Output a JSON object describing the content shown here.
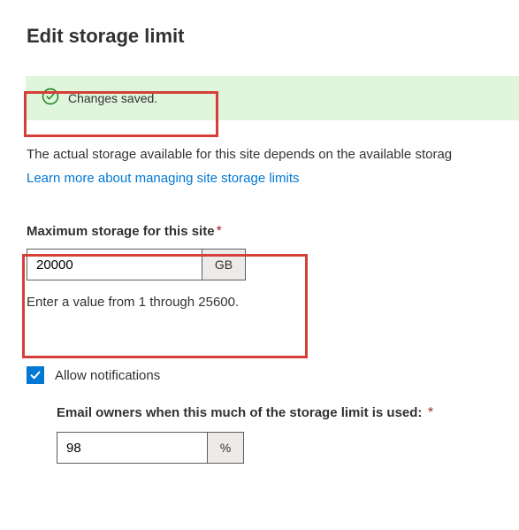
{
  "title": "Edit storage limit",
  "banner": {
    "text": "Changes saved."
  },
  "description": "The actual storage available for this site depends on the available storag",
  "link": "Learn more about managing site storage limits",
  "maxStorage": {
    "label": "Maximum storage for this site",
    "value": "20000",
    "unit": "GB",
    "hint": "Enter a value from 1 through 25600."
  },
  "allowNotifications": {
    "label": "Allow notifications",
    "checked": true
  },
  "emailThreshold": {
    "label": "Email owners when this much of the storage limit is used:",
    "value": "98",
    "unit": "%"
  }
}
